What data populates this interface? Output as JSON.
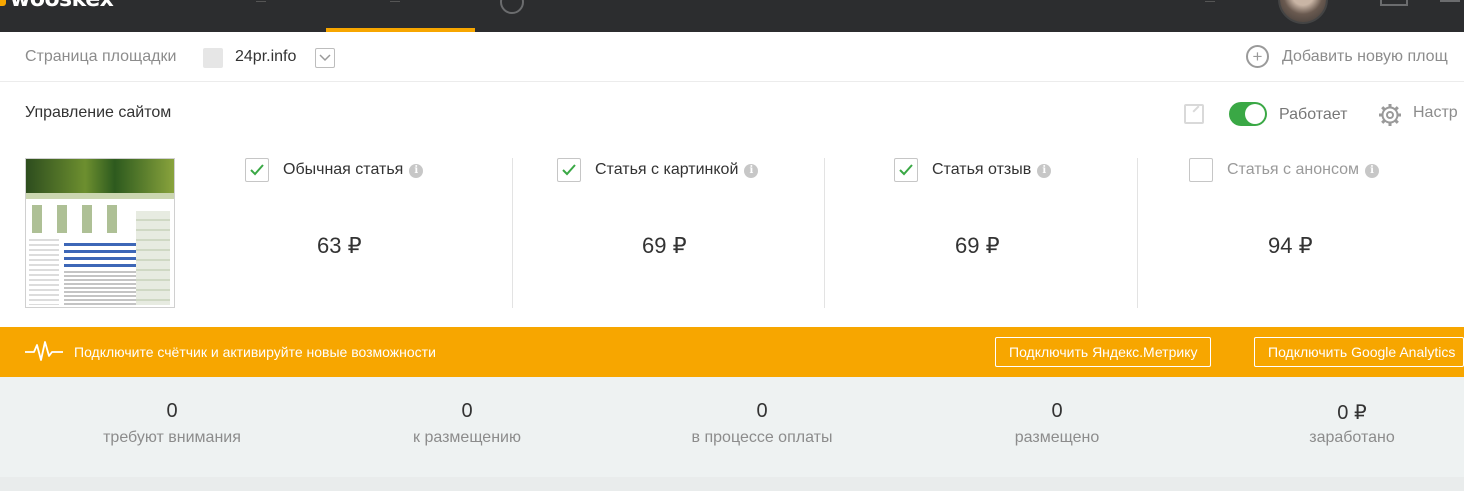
{
  "header": {
    "logo_text": "wooskex"
  },
  "site_selector": {
    "label": "Страница площадки",
    "domain": "24pr.info",
    "add_label": "Добавить новую площ"
  },
  "management": {
    "title": "Управление сайтом",
    "status_label": "Работает",
    "status_on": true,
    "settings_label": "Настр"
  },
  "article_types": [
    {
      "name": "Обычная статья",
      "price": "63 ₽",
      "checked": true
    },
    {
      "name": "Статья с картинкой",
      "price": "69 ₽",
      "checked": true
    },
    {
      "name": "Статья отзыв",
      "price": "69 ₽",
      "checked": true
    },
    {
      "name": "Статья с анонсом",
      "price": "94 ₽",
      "checked": false
    }
  ],
  "banner": {
    "text": "Подключите счётчик и активируйте новые возможности",
    "button_yandex": "Подключить Яндекс.Метрику",
    "button_google": "Подключить Google Analytics"
  },
  "stats": [
    {
      "value": "0",
      "label": "требуют внимания"
    },
    {
      "value": "0",
      "label": "к размещению"
    },
    {
      "value": "0",
      "label": "в процессе оплаты"
    },
    {
      "value": "0",
      "label": "размещено"
    },
    {
      "value": "0 ₽",
      "label": "заработано"
    }
  ],
  "colors": {
    "accent": "#f7a600",
    "topbar": "#2c2d2f",
    "toggle_on": "#3aa845",
    "check": "#3aa845"
  }
}
